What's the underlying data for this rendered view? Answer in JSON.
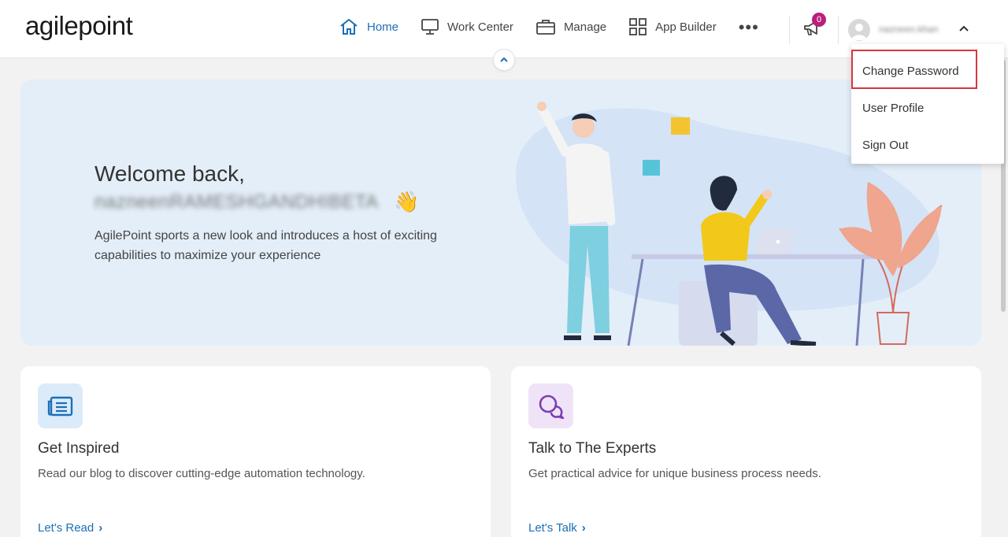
{
  "brand": {
    "logo_text": "agilepoint"
  },
  "nav": {
    "items": [
      {
        "label": "Home",
        "icon": "home-icon",
        "active": true
      },
      {
        "label": "Work Center",
        "icon": "monitor-icon",
        "active": false
      },
      {
        "label": "Manage",
        "icon": "briefcase-icon",
        "active": false
      },
      {
        "label": "App Builder",
        "icon": "grid-icon",
        "active": false
      }
    ],
    "more_label": "•••"
  },
  "notifications": {
    "count": "0",
    "icon": "megaphone-icon"
  },
  "user": {
    "display_name": "nazneen.khan",
    "menu": [
      "Change Password",
      "User Profile",
      "Sign Out"
    ]
  },
  "banner": {
    "greeting": "Welcome back,",
    "name": "nazneenRAMESHGANDHIBETA",
    "wave_emoji": "👋",
    "intro": "AgilePoint sports a new look and introduces a host of exciting capabilities to maximize your experience"
  },
  "cards": [
    {
      "title": "Get Inspired",
      "desc": "Read our blog to discover cutting-edge automation technology.",
      "link": "Let's Read",
      "icon": "newspaper-icon",
      "icon_bg": "#dcebf9",
      "icon_color": "#1c6fb7"
    },
    {
      "title": "Talk to The Experts",
      "desc": "Get practical advice for unique business process needs.",
      "link": "Let's Talk",
      "icon": "chat-bubbles-icon",
      "icon_bg": "#efe4f7",
      "icon_color": "#7b3fb5"
    }
  ],
  "colors": {
    "accent": "#1c6fb7",
    "badge": "#b8207d",
    "highlight_border": "#d9363e"
  }
}
